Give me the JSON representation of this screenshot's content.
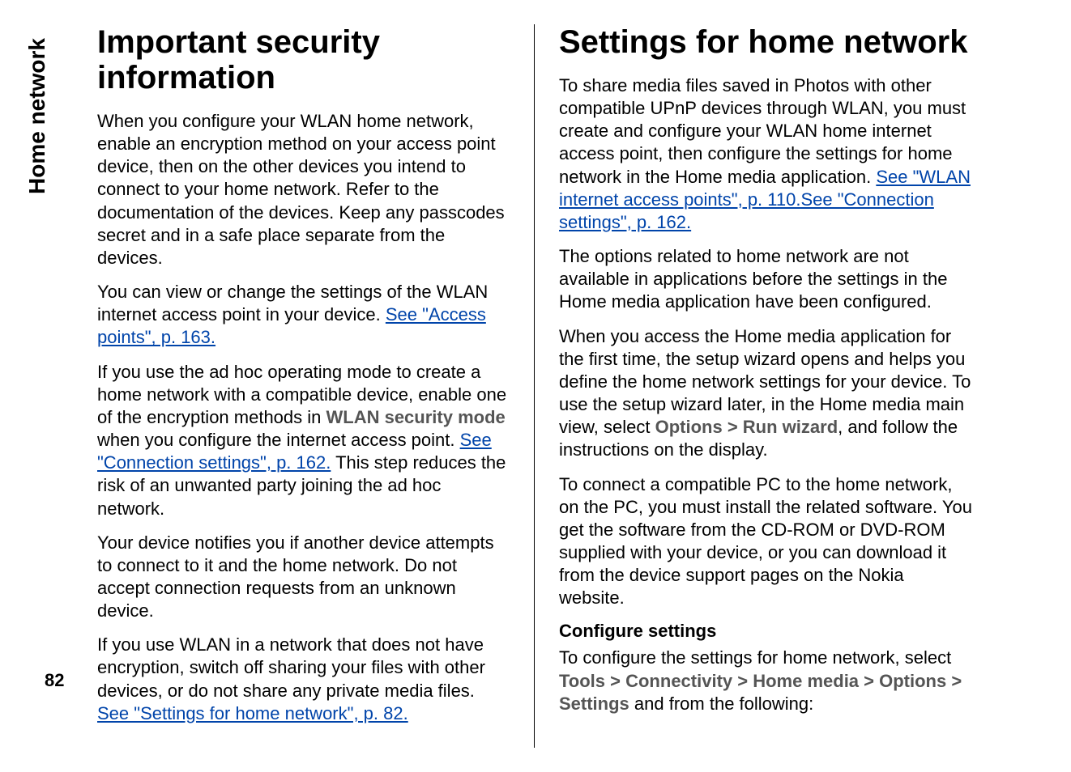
{
  "sidebar_label": "Home network",
  "page_number": "82",
  "left": {
    "heading": "Important security information",
    "p1": "When you configure your WLAN home network, enable an encryption method on your access point device, then on the other devices you intend to connect to your home network. Refer to the documentation of the devices. Keep any passcodes secret and in a safe place separate from the devices.",
    "p2a": "You can view or change the settings of the WLAN internet access point in your device. ",
    "p2_link": "See \"Access points\", p. 163.",
    "p3a": "If you use the ad hoc operating mode to create a home network with a compatible device, enable one of the encryption methods in ",
    "p3_bold": "WLAN security mode",
    "p3b": " when you configure the internet access point. ",
    "p3_link": "See \"Connection settings\", p. 162.",
    "p3c": " This step reduces the risk of an unwanted party joining the ad hoc network.",
    "p4": "Your device notifies you if another device attempts to connect to it and the home network. Do not accept connection requests from an unknown device.",
    "p5a": "If you use WLAN in a network that does not have encryption, switch off sharing your files with other devices, or do not share any private media files. ",
    "p5_link": "See \"Settings for home network\", p. 82."
  },
  "right": {
    "heading": "Settings for home network",
    "p1a": "To share media files saved in Photos with other compatible UPnP devices through WLAN, you must create and configure your WLAN home internet access point, then configure the settings for home network in the Home media application. ",
    "p1_link1": "See \"WLAN internet access points\", p. 110.",
    "p1_link2": "See \"Connection settings\", p. 162.",
    "p2": "The options related to home network are not available in applications before the settings in the Home media application have been configured.",
    "p3a": "When you access the Home media application for the first time, the setup wizard opens and helps you define the home network settings for your device. To use the setup wizard later, in the Home media main view, select ",
    "p3_opt": "Options",
    "p3_gt1": " > ",
    "p3_run": "Run wizard",
    "p3b": ", and follow the instructions on the display.",
    "p4": "To connect a compatible PC to the home network, on the PC, you must install the related software. You get the software from the CD-ROM or DVD-ROM supplied with your device, or you can download it from the device support pages on the Nokia website.",
    "subhead": "Configure settings",
    "p5a": "To configure the settings for home network, select ",
    "p5_tools": "Tools",
    "p5_gt": " > ",
    "p5_conn": "Connectivity",
    "p5_home": "Home media",
    "p5_opt": "Options",
    "p5_set": "Settings",
    "p5b": " and from the following:"
  }
}
